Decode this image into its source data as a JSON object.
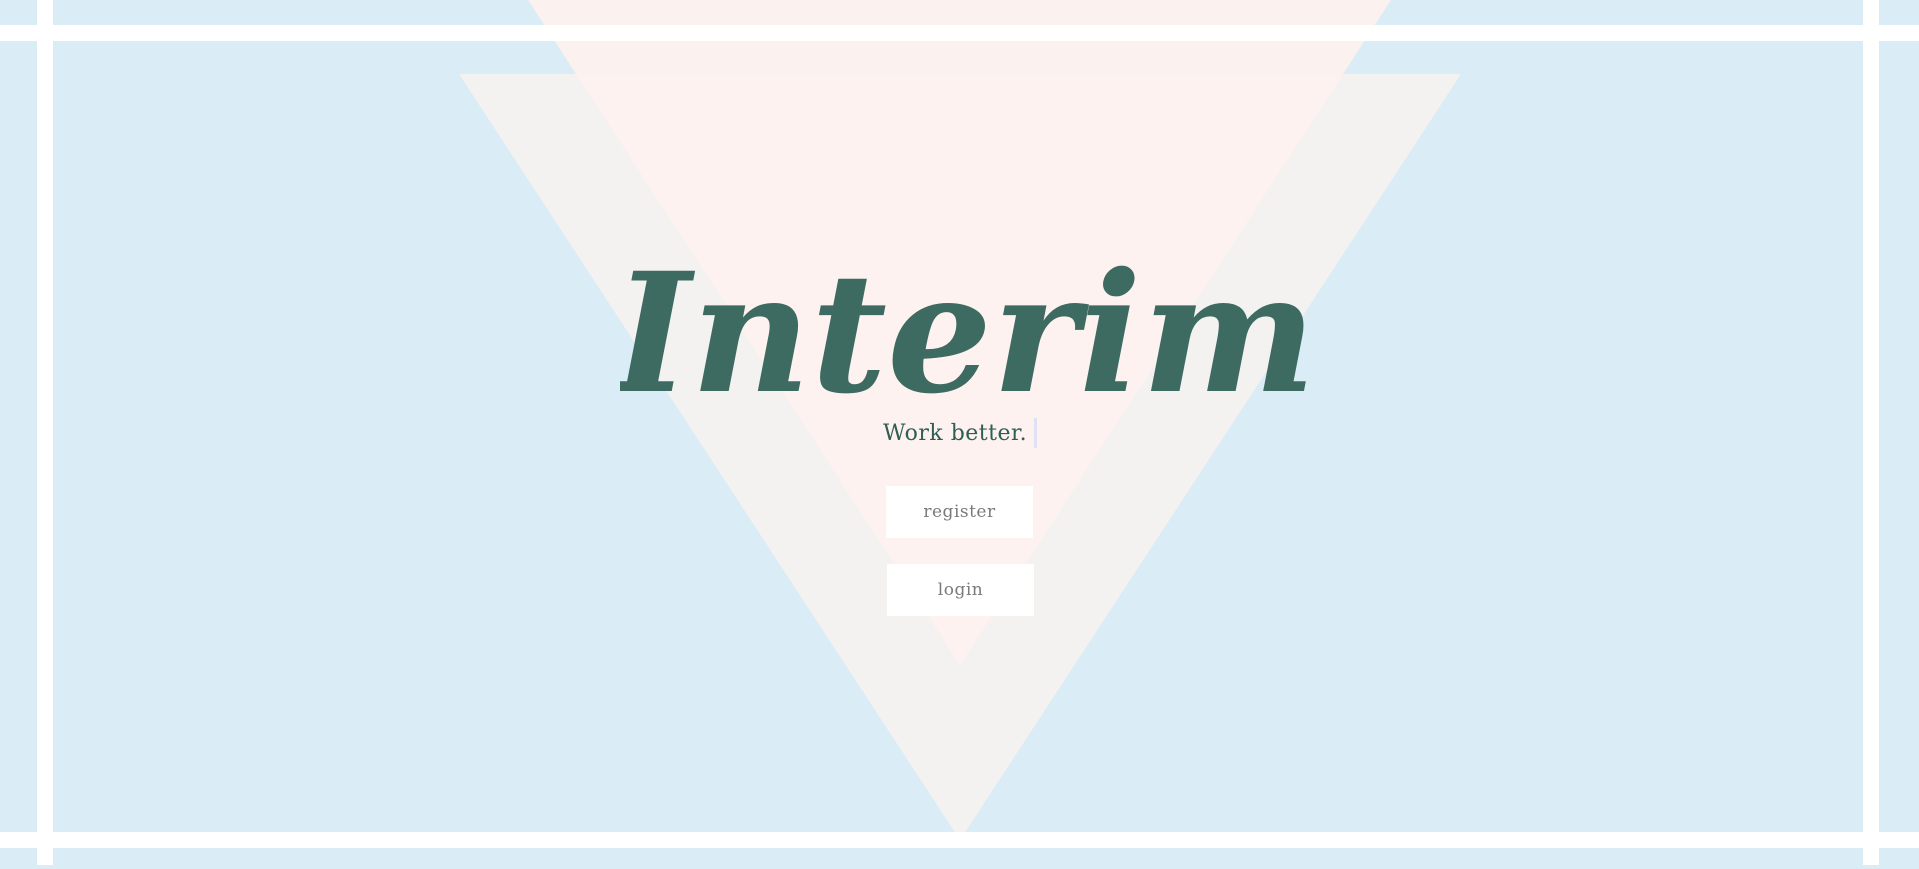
{
  "brand": {
    "name": "Interim",
    "tagline": "Work better."
  },
  "actions": {
    "register_label": "register",
    "login_label": "login"
  },
  "colors": {
    "background": "#daecf5",
    "frame_lines": "#ffffff",
    "triangle_pink": "#fdf1ee",
    "triangle_gray": "#f4f1f1",
    "logo_text": "#3d6b61",
    "button_bg": "#ffffff",
    "button_text": "#7a7a7a"
  }
}
